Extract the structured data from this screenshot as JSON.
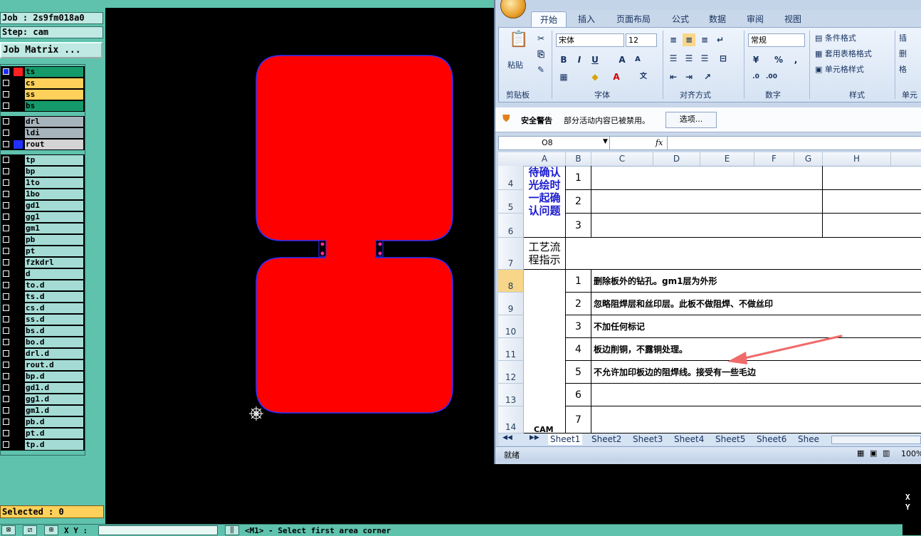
{
  "cam": {
    "job": "Job : 2s9fm018a0",
    "step": "Step: cam",
    "job_matrix": "Job Matrix ...",
    "selected": "Selected : 0",
    "layers_group1": [
      {
        "name": "ts",
        "color": "#159a6c",
        "swatch": "#ff2020",
        "checked": true
      },
      {
        "name": "cs",
        "color": "#ffd05a",
        "swatch": "",
        "checked": false
      },
      {
        "name": "ss",
        "color": "#ffd05a",
        "swatch": "",
        "checked": false
      },
      {
        "name": "bs",
        "color": "#159a6c",
        "swatch": "",
        "checked": false
      }
    ],
    "layers_group2": [
      {
        "name": "drl",
        "color": "#a8b4bc",
        "swatch": "",
        "checked": false
      },
      {
        "name": "ldi",
        "color": "#a8b4bc",
        "swatch": "",
        "checked": false
      },
      {
        "name": "rout",
        "color": "#d4d4d4",
        "swatch": "#2030ff",
        "checked": false
      }
    ],
    "layers_group3": [
      "tp",
      "bp",
      "1to",
      "1bo",
      "gd1",
      "gg1",
      "gm1",
      "pb",
      "pt",
      "fzkdrl",
      "d",
      "to.d",
      "ts.d",
      "cs.d",
      "ss.d",
      "bs.d",
      "bo.d",
      "drl.d",
      "rout.d",
      "bp.d",
      "gd1.d",
      "gg1.d",
      "gm1.d",
      "pb.d",
      "pt.d",
      "tp.d"
    ],
    "xy_label": "X Y :",
    "prompt": "<M1> - Select first area corner",
    "xy_readout": [
      "X",
      "Y"
    ]
  },
  "excel": {
    "tabs": [
      "开始",
      "插入",
      "页面布局",
      "公式",
      "数据",
      "审阅",
      "视图"
    ],
    "clipboard": {
      "paste": "粘贴",
      "label": "剪贴板"
    },
    "font": {
      "name": "宋体",
      "size": "12",
      "label": "字体",
      "bold": "B",
      "italic": "I",
      "underline": "U"
    },
    "alignment": {
      "label": "对齐方式"
    },
    "number": {
      "format": "常规",
      "label": "数字",
      "percent": "%"
    },
    "styles": {
      "cond": "条件格式",
      "table": "套用表格格式",
      "cell": "单元格样式",
      "label": "样式"
    },
    "cells": {
      "insert": "插",
      "delete": "删",
      "format": "格",
      "label": "单元"
    },
    "security": {
      "title": "安全警告",
      "message": "部分活动内容已被禁用。",
      "options": "选项..."
    },
    "name_box": "O8",
    "fx": "fx",
    "columns": [
      "A",
      "B",
      "C",
      "D",
      "E",
      "F",
      "G",
      "H"
    ],
    "rows": [
      "4",
      "5",
      "6",
      "7",
      "8",
      "9",
      "10",
      "11",
      "12",
      "13",
      "14"
    ],
    "pending_label": "待确认光绘时一起确认问题",
    "pending_nums": [
      "1",
      "2",
      "3"
    ],
    "process_label": "工艺流程指示",
    "steps": [
      {
        "n": "1",
        "text": "删除板外的钻孔。gm1层为外形"
      },
      {
        "n": "2",
        "text": "忽略阻焊层和丝印层。此板不做阻焊、不做丝印"
      },
      {
        "n": "3",
        "text": "不加任何标记"
      },
      {
        "n": "4",
        "text": "板边削铜，不露铜处理。"
      },
      {
        "n": "5",
        "text": "不允许加印板边的阻焊线。接受有一些毛边"
      },
      {
        "n": "6",
        "text": ""
      },
      {
        "n": "7",
        "text": ""
      }
    ],
    "partial_cell": "CAM",
    "sheets": [
      "Sheet1",
      "Sheet2",
      "Sheet3",
      "Sheet4",
      "Sheet5",
      "Sheet6",
      "Shee"
    ],
    "status": "就绪",
    "zoom": "100%"
  },
  "colors": {
    "pad": "#ff0000",
    "outline": "#3030ff",
    "arrow": "#f06a6a",
    "panel": "#5fc2ad"
  }
}
